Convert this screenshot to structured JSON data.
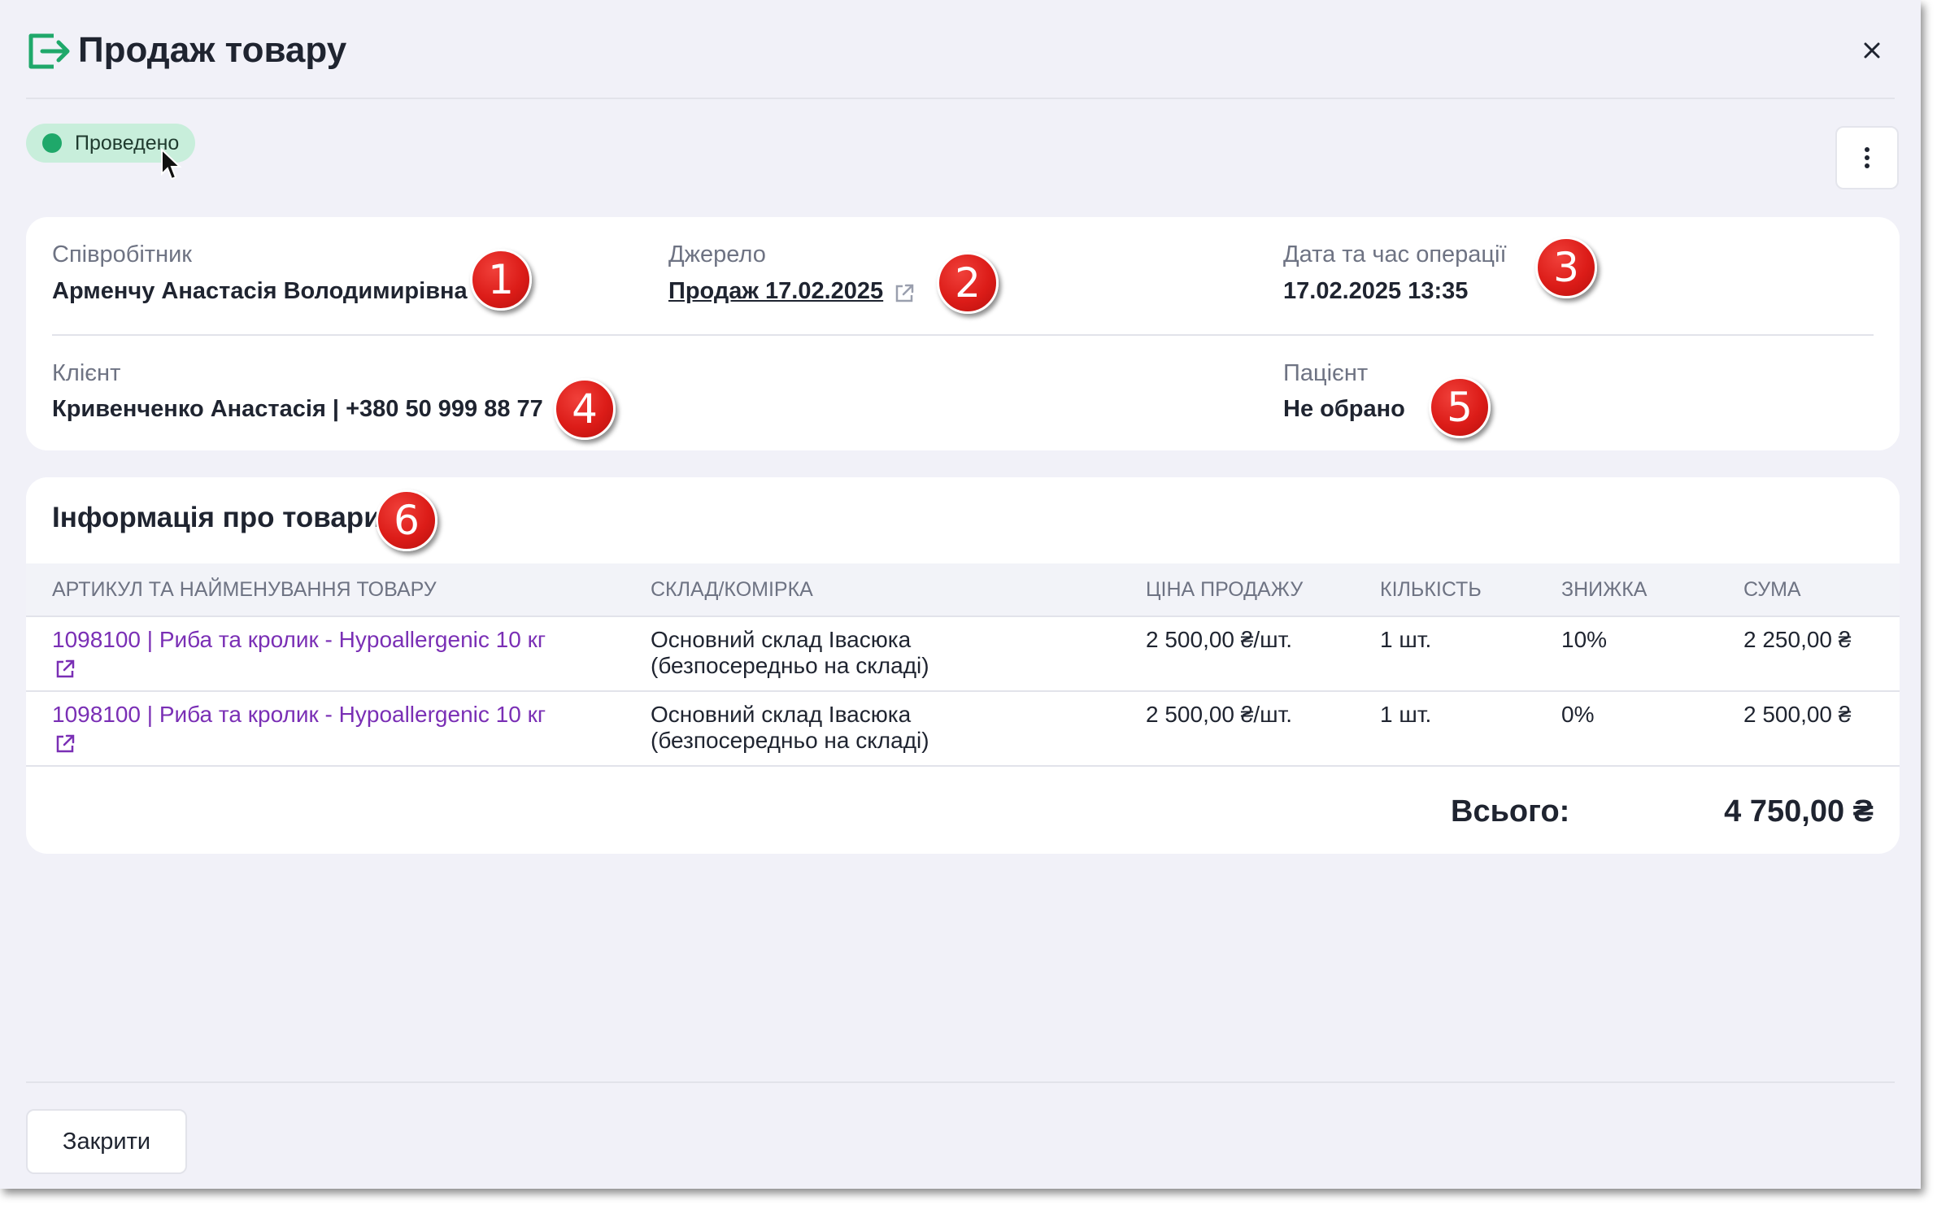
{
  "dialog": {
    "title": "Продаж товару",
    "close_icon": "close-icon",
    "brand_color": "#1fa86a"
  },
  "status": {
    "label": "Проведено",
    "color": "#1fa86a"
  },
  "info": {
    "employee": {
      "label": "Співробітник",
      "value": "Арменчу Анастасія Володимирівна"
    },
    "source": {
      "label": "Джерело",
      "value": "Продаж 17.02.2025"
    },
    "datetime": {
      "label": "Дата та час операції",
      "value": "17.02.2025 13:35"
    },
    "client": {
      "label": "Клієнт",
      "value": "Кривенченко Анастасія | +380 50 999 88 77"
    },
    "patient": {
      "label": "Пацієнт",
      "value": "Не обрано"
    }
  },
  "goods": {
    "title": "Інформація про товари",
    "columns": [
      "Артикул та найменування товару",
      "Склад/комірка",
      "Ціна продажу",
      "Кількість",
      "Знижка",
      "Сума"
    ],
    "rows": [
      {
        "product": "1098100 | Риба та кролик - Hypoallergenic 10 кг",
        "warehouse_line1": "Основний склад Івасюка",
        "warehouse_line2": "(безпосередньо на складі)",
        "price": "2 500,00 ₴/шт.",
        "qty": "1 шт.",
        "discount": "10%",
        "sum": "2 250,00 ₴"
      },
      {
        "product": "1098100 | Риба та кролик - Hypoallergenic 10 кг",
        "warehouse_line1": "Основний склад Івасюка",
        "warehouse_line2": "(безпосередньо на складі)",
        "price": "2 500,00 ₴/шт.",
        "qty": "1 шт.",
        "discount": "0%",
        "sum": "2 500,00 ₴"
      }
    ],
    "total_label": "Всього:",
    "total_value": "4 750,00 ₴"
  },
  "markers": [
    "1",
    "2",
    "3",
    "4",
    "5",
    "6"
  ],
  "footer": {
    "close_label": "Закрити"
  }
}
